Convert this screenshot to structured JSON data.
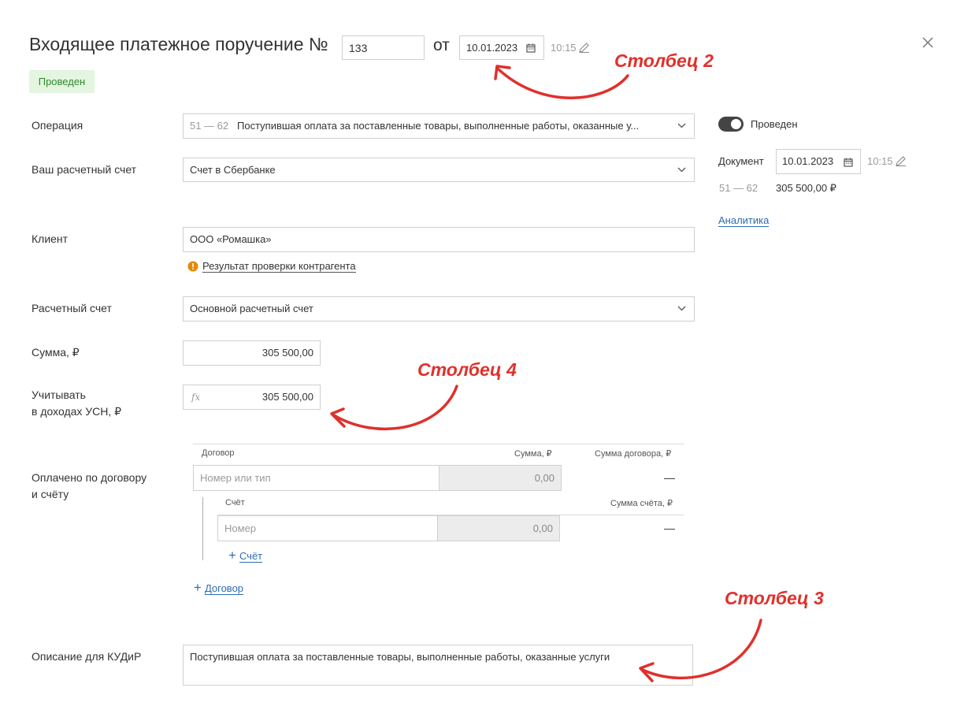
{
  "header": {
    "title": "Входящее платежное поручение №",
    "number": "133",
    "ot_label": "от",
    "date": "10.01.2023",
    "time": "10:15"
  },
  "status_badge": "Проведен",
  "form": {
    "operation": {
      "label": "Операция",
      "code": "51 — 62",
      "value": "Поступившая оплата за поставленные товары, выполненные работы, оказанные у..."
    },
    "account": {
      "label": "Ваш расчетный счет",
      "value": "Счет в Сбербанке"
    },
    "client": {
      "label": "Клиент",
      "value": "ООО «Ромашка»",
      "check_link": "Результат проверки контрагента"
    },
    "settlement": {
      "label": "Расчетный счет",
      "value": "Основной расчетный счет"
    },
    "sum": {
      "label": "Сумма, ₽",
      "value": "305 500,00"
    },
    "usn": {
      "label_line1": "Учитывать",
      "label_line2": "в доходах УСН, ₽",
      "fx": "fx",
      "value": "305 500,00"
    },
    "contract": {
      "label_line1": "Оплачено по договору",
      "label_line2": "и счёту",
      "col_contract": "Договор",
      "col_sum": "Сумма, ₽",
      "col_contract_sum": "Сумма договора, ₽",
      "contract_placeholder": "Номер или тип",
      "contract_sum": "0,00",
      "contract_total": "—",
      "col_invoice": "Счёт",
      "col_invoice_sum": "Сумма счёта, ₽",
      "invoice_placeholder": "Номер",
      "invoice_sum": "0,00",
      "invoice_total": "—",
      "add_invoice": "Счёт",
      "add_contract": "Договор"
    },
    "kudir": {
      "label": "Описание для КУДиР",
      "value": "Поступившая оплата за поставленные товары, выполненные работы, оказанные услуги"
    }
  },
  "sidebar": {
    "toggle_label": "Проведен",
    "doc_label": "Документ",
    "doc_date": "10.01.2023",
    "doc_time": "10:15",
    "entry_code": "51 — 62",
    "entry_sum": "305 500,00 ₽",
    "analytics_link": "Аналитика"
  },
  "annotations": {
    "col2": "Столбец 2",
    "col3": "Столбец 3",
    "col4": "Столбец 4"
  },
  "colors": {
    "annotation": "#e0302b",
    "link": "#2b6cb0",
    "badge_bg": "#e4f5e0",
    "badge_text": "#2e8a2e"
  }
}
